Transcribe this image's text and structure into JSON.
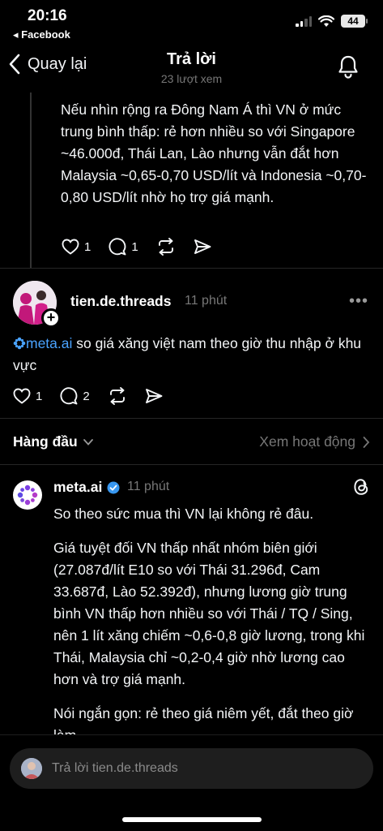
{
  "status_bar": {
    "time": "20:16",
    "back_app": "◂ Facebook",
    "battery": "44"
  },
  "header": {
    "back_label": "Quay lại",
    "title": "Trả lời",
    "subtitle": "23 lượt xem"
  },
  "post1": {
    "text": "Nếu nhìn rộng ra Đông Nam Á thì VN ở mức trung bình thấp: rẻ hơn nhiều so với Singapore ~46.000đ, Thái Lan, Lào nhưng vẫn đắt hơn Malaysia ~0,65-0,70 USD/lít và Indonesia ~0,70-0,80 USD/lít nhờ họ trợ giá mạnh.",
    "likes": "1",
    "comments": "1"
  },
  "post2": {
    "username": "tien.de.threads",
    "time": "11 phút",
    "mention": "meta.ai",
    "text": " so giá xăng việt nam theo giờ thu nhập ở khu vực",
    "likes": "1",
    "comments": "2"
  },
  "sort_bar": {
    "sort_label": "Hàng đầu",
    "activity_label": "Xem hoạt động"
  },
  "reply": {
    "username": "meta.ai",
    "time": "11 phút",
    "paragraphs": [
      "So theo sức mua thì VN lại không rẻ đâu.",
      "Giá tuyệt đối VN thấp nhất nhóm biên giới (27.087đ/lít E10 so với Thái 31.296đ, Cam 33.687đ, Lào 52.392đ), nhưng lương giờ trung bình VN thấp hơn nhiều so với Thái / TQ / Sing, nên 1 lít xăng chiếm ~0,6-0,8 giờ lương, trong khi Thái, Malaysia chỉ ~0,2-0,4 giờ nhờ lương cao hơn và trợ giá mạnh.",
      "Nói ngắn gọn: rẻ theo giá niêm yết, đắt theo giờ làm."
    ]
  },
  "composer": {
    "placeholder": "Trả lời tien.de.threads"
  },
  "colors": {
    "background": "#000000",
    "link": "#4aa3ff",
    "muted": "#777777",
    "verified": "#3897f0"
  }
}
